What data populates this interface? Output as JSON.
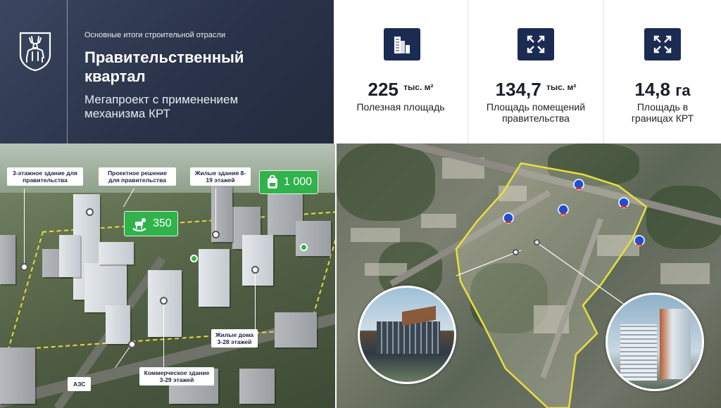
{
  "header": {
    "kicker": "Основные итоги строительной отрасли",
    "title": "Правительственный квартал",
    "subtitle": "Мегапроект с применением механизма КРТ",
    "logo_icon": "deer-coat-of-arms-icon"
  },
  "stats": [
    {
      "value": "225",
      "unit": "тыс. м²",
      "label": "Полезная площадь",
      "icon": "building-icon"
    },
    {
      "value": "134,7",
      "unit": "тыс. м²",
      "label": "Площадь помещений правительства",
      "icon": "expand-arrows-icon"
    },
    {
      "value": "14,8",
      "unit": "га",
      "label": "Площадь в границах КРТ",
      "icon": "expand-arrows-icon"
    }
  ],
  "render": {
    "labels": {
      "gov_building": "3-этажное здание для правительства",
      "project": "Проектное решение для правительства",
      "residential_top": "Жилые здания 8-19 этажей",
      "residential_bottom": "Жилые дома 3-28 этажей",
      "commercial": "Коммерческое здание 3-29 этажей",
      "gas_station": "АЗС"
    },
    "badges": {
      "school": "1 000",
      "kindergarten": "350"
    }
  },
  "colors": {
    "header_bg": "#2a3349",
    "icon_bg": "#1c2b52",
    "badge_green": "#2fb34a",
    "boundary_yellow": "#e8e03a"
  }
}
